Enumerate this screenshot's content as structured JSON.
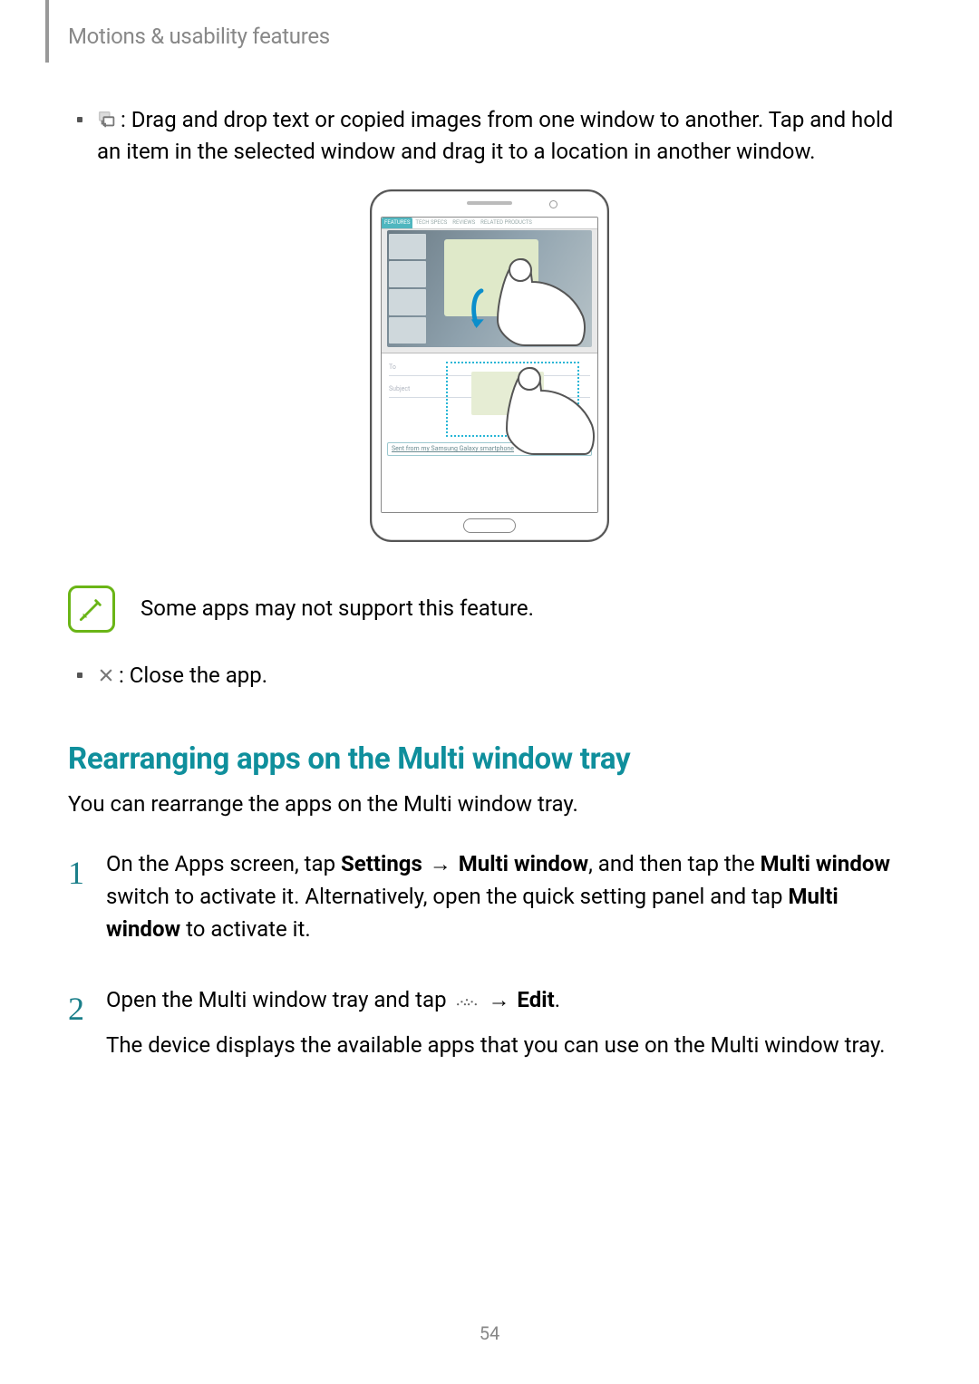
{
  "header": {
    "section": "Motions & usability features"
  },
  "bullets": {
    "drag_drop": ": Drag and drop text or copied images from one window to another. Tap and hold an item in the selected window and drag it to a location in another window.",
    "close_app": ": Close the app."
  },
  "illustration": {
    "tabs": {
      "active": "FEATURES",
      "t2": "TECH SPECS",
      "t3": "REVIEWS",
      "t4": "RELATED PRODUCTS"
    },
    "signature": "Sent from my Samsung Galaxy smartphone",
    "email_to": "To",
    "email_subject": "Subject"
  },
  "note": {
    "text": "Some apps may not support this feature."
  },
  "heading": {
    "rearranging": "Rearranging apps on the Multi window tray"
  },
  "intro": {
    "text": "You can rearrange the apps on the Multi window tray."
  },
  "steps": {
    "one_num": "1",
    "one_a": "On the Apps screen, tap ",
    "one_b_bold": "Settings",
    "one_arrow1": " → ",
    "one_c_bold": "Multi window",
    "one_d": ", and then tap the ",
    "one_e_bold": "Multi window",
    "one_f": " switch to activate it. Alternatively, open the quick setting panel and tap ",
    "one_g_bold": "Multi window",
    "one_h": " to activate it.",
    "two_num": "2",
    "two_a": "Open the Multi window tray and tap ",
    "two_arrow": " → ",
    "two_b_bold": "Edit",
    "two_c": ".",
    "two_d": "The device displays the available apps that you can use on the Multi window tray."
  },
  "page_number": "54"
}
